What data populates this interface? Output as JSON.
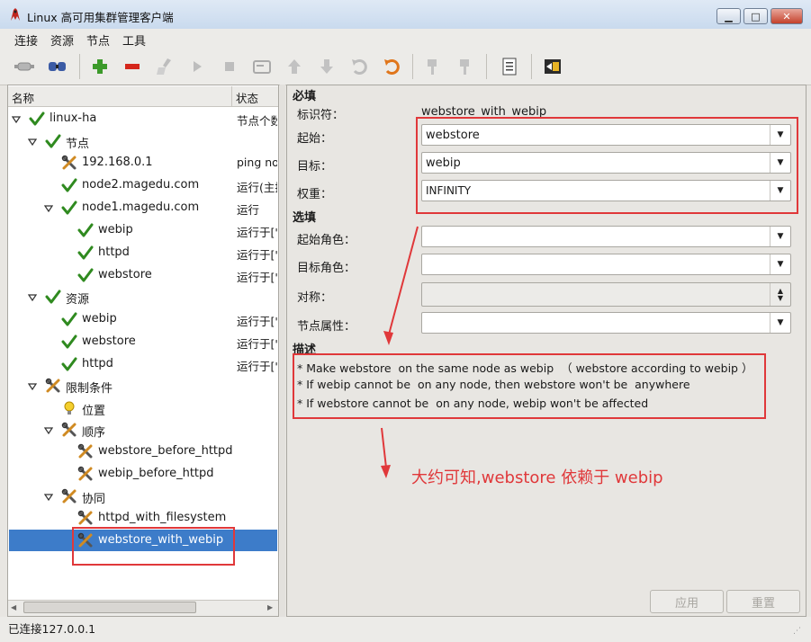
{
  "window": {
    "title": "Linux 高可用集群管理客户端"
  },
  "menu": [
    "连接",
    "资源",
    "节点",
    "工具"
  ],
  "tree": {
    "col_name": "名称",
    "col_status": "状态",
    "rows": [
      {
        "label": "linux-ha",
        "status": "节点个数",
        "icon": "check-icon"
      },
      {
        "label": "节点",
        "status": "",
        "icon": "check-icon"
      },
      {
        "label": "192.168.0.1",
        "status": "ping node",
        "icon": "tools-icon"
      },
      {
        "label": "node2.magedu.com",
        "status": "运行(主持)",
        "icon": "check-icon"
      },
      {
        "label": "node1.magedu.com",
        "status": "运行",
        "icon": "check-icon"
      },
      {
        "label": "webip",
        "status": "运行于['n",
        "icon": "check-icon"
      },
      {
        "label": "httpd",
        "status": "运行于['n",
        "icon": "check-icon"
      },
      {
        "label": "webstore",
        "status": "运行于['n",
        "icon": "check-icon"
      },
      {
        "label": "资源",
        "status": "",
        "icon": "check-icon"
      },
      {
        "label": "webip",
        "status": "运行于['n",
        "icon": "check-icon"
      },
      {
        "label": "webstore",
        "status": "运行于['n",
        "icon": "check-icon"
      },
      {
        "label": "httpd",
        "status": "运行于['n",
        "icon": "check-icon"
      },
      {
        "label": "限制条件",
        "status": "",
        "icon": "tools-icon"
      },
      {
        "label": "位置",
        "status": "",
        "icon": "bulb-icon"
      },
      {
        "label": "顺序",
        "status": "",
        "icon": "tools-icon"
      },
      {
        "label": "webstore_before_httpd",
        "status": "",
        "icon": "tools-icon"
      },
      {
        "label": "webip_before_httpd",
        "status": "",
        "icon": "tools-icon"
      },
      {
        "label": "协同",
        "status": "",
        "icon": "tools-icon"
      },
      {
        "label": "httpd_with_filesystem",
        "status": "",
        "icon": "tools-icon"
      },
      {
        "label": "webstore_with_webip",
        "status": "",
        "icon": "tools-icon",
        "selected": true
      }
    ]
  },
  "form": {
    "required_title": "必填",
    "id_label": "标识符：",
    "id_value": "webstore_with_webip",
    "from_label": "起始：",
    "from_value": "webstore",
    "to_label": "目标：",
    "to_value": "webip",
    "score_label": "权重：",
    "score_value": "INFINITY",
    "optional_title": "选填",
    "from_role_label": "起始角色：",
    "to_role_label": "目标角色：",
    "symmetric_label": "对称：",
    "node_attr_label": "节点属性：",
    "desc_title": "描述",
    "desc_lines": [
      "* Make webstore  on the same node as webip  （ webstore according to webip ）",
      "* If webip cannot be  on any node, then webstore won't be  anywhere",
      "* If webstore cannot be  on any node, webip won't be affected"
    ],
    "annotation": "大约可知,webstore 依赖于 webip",
    "apply_label": "应用",
    "reset_label": "重置"
  },
  "status_bar": "已连接127.0.0.1",
  "colors": {
    "accent": "#3d7cc9",
    "annotation": "#e0383a"
  }
}
